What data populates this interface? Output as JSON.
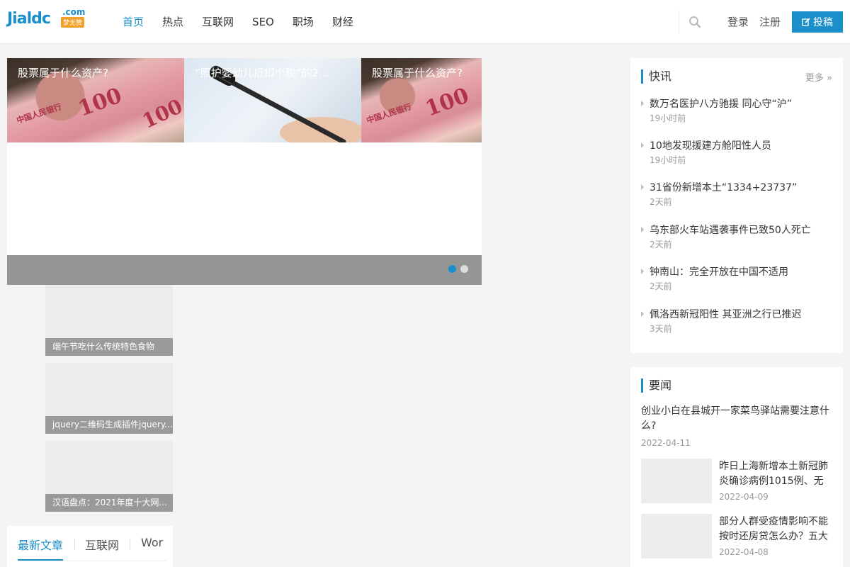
{
  "header": {
    "logo_main": "Jialdc",
    "logo_com": ".com",
    "logo_tag": "梦无赞",
    "nav": [
      {
        "label": "首页",
        "active": true
      },
      {
        "label": "热点",
        "active": false
      },
      {
        "label": "互联网",
        "active": false
      },
      {
        "label": "SEO",
        "active": false
      },
      {
        "label": "职场",
        "active": false
      },
      {
        "label": "财经",
        "active": false
      }
    ],
    "login": "登录",
    "register": "注册",
    "submit": "投稿"
  },
  "slider": {
    "captions": [
      "股票属于什么资产?",
      "“照护婴幼儿抵扣个税”的2...",
      "股票属于什么资产?"
    ],
    "active_dot": 0
  },
  "thumbs": [
    {
      "caption": "端午节吃什么传统特色食物"
    },
    {
      "caption": "jquery二维码生成插件jquery..."
    },
    {
      "caption": "汉语盘点：2021年度十大网..."
    }
  ],
  "tabs": [
    {
      "label": "最新文章",
      "active": true
    },
    {
      "label": "互联网",
      "active": false
    },
    {
      "label": "Wor",
      "active": false
    }
  ],
  "flash": {
    "title": "快讯",
    "more": "更多 »",
    "items": [
      {
        "title": "数万名医护八方驰援 同心守“沪”",
        "time": "19小时前"
      },
      {
        "title": "10地发现援建方舱阳性人员",
        "time": "19小时前"
      },
      {
        "title": "31省份新增本土“1334+23737”",
        "time": "2天前"
      },
      {
        "title": "乌东部火车站遇袭事件已致50人死亡",
        "time": "2天前"
      },
      {
        "title": "钟南山：完全开放在中国不适用",
        "time": "2天前"
      },
      {
        "title": "佩洛西新冠阳性 其亚洲之行已推迟",
        "time": "3天前"
      }
    ]
  },
  "news": {
    "title": "要闻",
    "headline": "创业小白在县城开一家菜鸟驿站需要注意什么?",
    "headline_date": "2022-04-11",
    "items": [
      {
        "title": "昨日上海新增本土新冠肺炎确诊病例1015例、无症",
        "date": "2022-04-09"
      },
      {
        "title": "部分人群受疫情影响不能按时还房贷怎么办？五大",
        "date": "2022-04-08"
      }
    ]
  },
  "colors": {
    "accent": "#1a8fc9"
  }
}
